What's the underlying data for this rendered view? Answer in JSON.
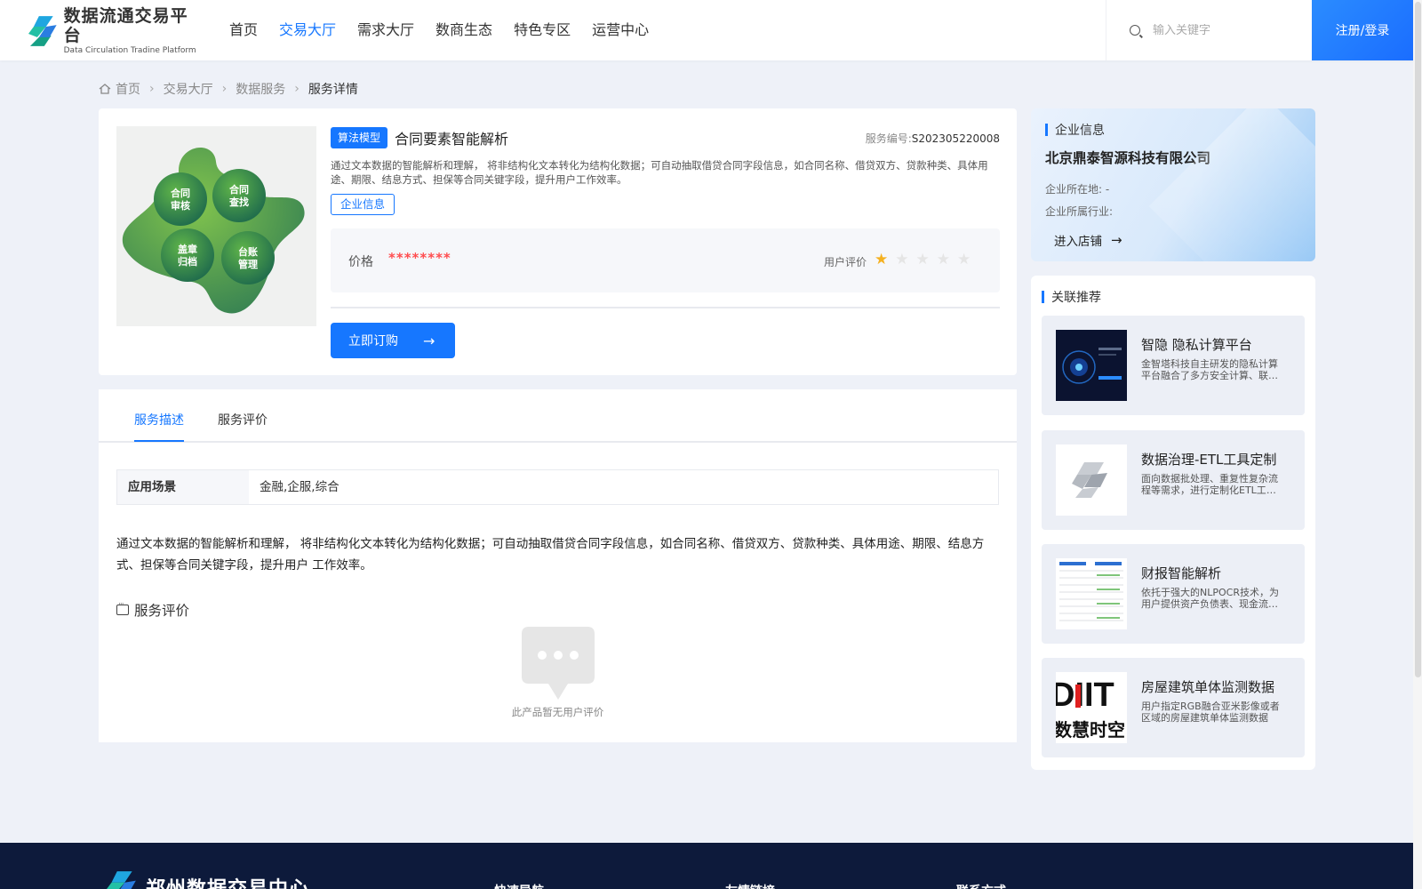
{
  "header": {
    "logo_cn": "数据流通交易平台",
    "logo_en": "Data Circulation Tradine Platform",
    "nav": [
      "首页",
      "交易大厅",
      "需求大厅",
      "数商生态",
      "特色专区",
      "运营中心"
    ],
    "active_nav": "交易大厅",
    "search_placeholder": "输入关键字",
    "login_label": "注册/登录"
  },
  "breadcrumb": [
    "首页",
    "交易大厅",
    "数据服务",
    "服务详情"
  ],
  "product": {
    "tag": "算法模型",
    "title": "合同要素智能解析",
    "service_no_label": "服务编号:",
    "service_no": "S202305220008",
    "description": "通过文本数据的智能解析和理解， 将非结构化文本转化为结构化数据；可自动抽取借贷合同字段信息，如合同名称、借贷双方、贷款种类、具体用途、期限、结息方式、担保等合同关键字段，提升用户工作效率。",
    "company_tag": "企业信息",
    "price_label": "价格",
    "price_value": "********",
    "rating_label": "用户评价",
    "rating": 1,
    "rating_max": 5,
    "order_label": "立即订购",
    "image_labels": [
      "合同\n审核",
      "合同\n查找",
      "盖章\n归档",
      "台账\n管理"
    ]
  },
  "tabs": {
    "items": [
      "服务描述",
      "服务评价"
    ],
    "active": "服务描述"
  },
  "detail": {
    "scene_key": "应用场景",
    "scene_value": "金融,企服,综合",
    "description": "通过文本数据的智能解析和理解， 将非结构化文本转化为结构化数据；可自动抽取借贷合同字段信息，如合同名称、借贷双方、贷款种类、具体用途、期限、结息方式、担保等合同关键字段，提升用户 工作效率。",
    "review_heading": "服务评价",
    "empty_text": "此产品暂无用户评价"
  },
  "company": {
    "heading": "企业信息",
    "name": "北京鼎泰智源科技有限公司",
    "location_label": "企业所在地: -",
    "industry_label": "企业所属行业:",
    "enter_label": "进入店铺"
  },
  "related": {
    "heading": "关联推荐",
    "items": [
      {
        "title": "智隐 隐私计算平台",
        "desc": "金智塔科技自主研发的隐私计算平台融合了多方安全计算、联邦学习等技术"
      },
      {
        "title": "数据治理-ETL工具定制",
        "desc": "面向数据批处理、重复性复杂流程等需求，进行定制化ETL工具开发"
      },
      {
        "title": "财报智能解析",
        "desc": "依托于强大的NLPOCR技术，为用户提供资产负债表、现金流量表等解析"
      },
      {
        "title": "房屋建筑单体监测数据",
        "desc": "用户指定RGB融合亚米影像或者区域的房屋建筑单体监测数据"
      }
    ],
    "thumb4_text_top": "DIIT",
    "thumb4_text_bottom": "数慧时空"
  },
  "footer": {
    "title": "郑州数据交易中心",
    "cols": [
      "快速导航",
      "友情链接",
      "联系方式"
    ]
  },
  "colors": {
    "primary": "#1677ff",
    "price": "#ff4d4f",
    "star": "#f5b120",
    "footer_bg": "#0d1a3b"
  }
}
